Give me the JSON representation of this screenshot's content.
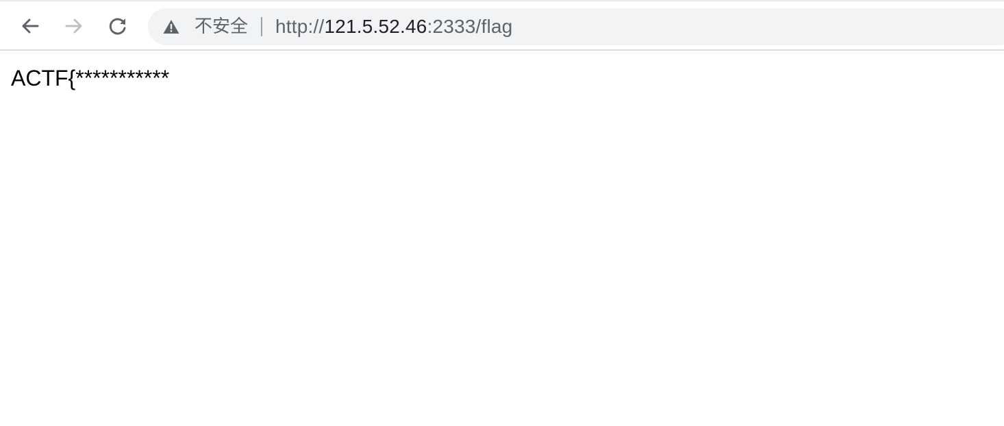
{
  "toolbar": {
    "back_icon": "arrow-left-icon",
    "forward_icon": "arrow-right-icon",
    "reload_icon": "reload-icon"
  },
  "omnibox": {
    "security_icon": "warning-triangle-icon",
    "security_label": "不安全",
    "url_scheme": "http://",
    "url_host": "121.5.52.46",
    "url_rest": ":2333/flag"
  },
  "page": {
    "body_text": "ACTF{***********"
  },
  "colors": {
    "icon_active": "#5f6368",
    "icon_disabled": "#bdc1c6",
    "omnibox_bg": "#f1f3f4"
  }
}
